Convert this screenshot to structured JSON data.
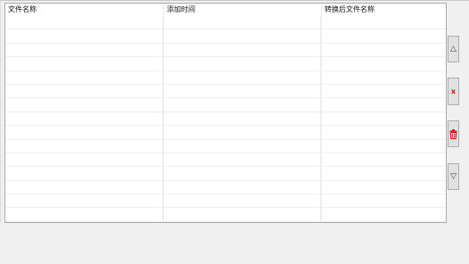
{
  "file_list": {
    "columns": [
      "文件名称",
      "添加时间",
      "转换后文件名称"
    ],
    "rows": [
      [
        "",
        "",
        ""
      ],
      [
        "",
        "",
        ""
      ],
      [
        "",
        "",
        ""
      ],
      [
        "",
        "",
        ""
      ],
      [
        "",
        "",
        ""
      ],
      [
        "",
        "",
        ""
      ],
      [
        "",
        "",
        ""
      ],
      [
        "",
        "",
        ""
      ],
      [
        "",
        "",
        ""
      ],
      [
        "",
        "",
        ""
      ],
      [
        "",
        "",
        ""
      ],
      [
        "",
        "",
        ""
      ],
      [
        "",
        "",
        ""
      ],
      [
        "",
        "",
        ""
      ],
      [
        "",
        "",
        ""
      ]
    ]
  },
  "side_buttons": {
    "move_up_glyph": "△",
    "remove_glyph": "x",
    "delete_icon": "trash-icon",
    "move_down_glyph": "▽",
    "delete_color": "#e01010"
  }
}
